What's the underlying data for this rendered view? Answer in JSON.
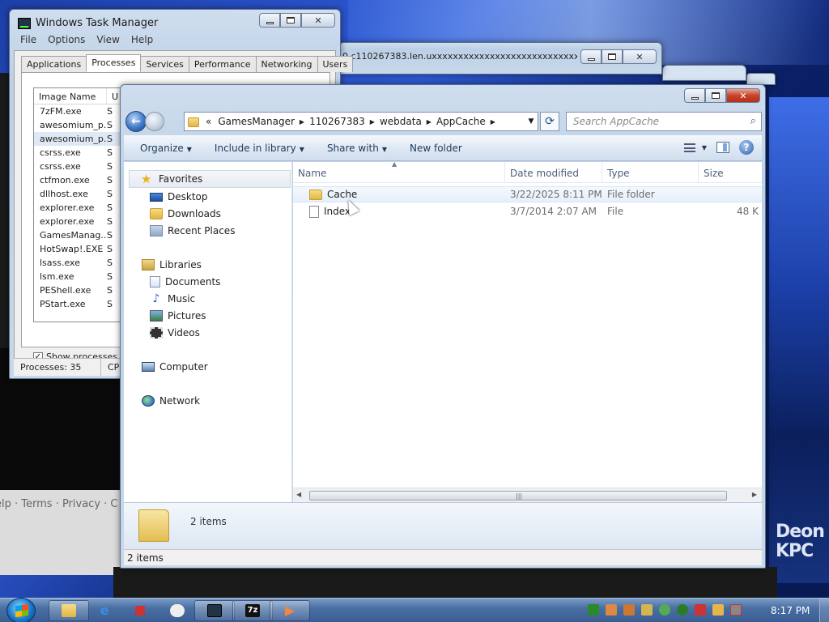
{
  "desktop": {
    "footer_links": "elp · Terms · Privacy · C",
    "right_text": "Deon\nKPC"
  },
  "taskmgr": {
    "title": "Windows Task Manager",
    "menu": [
      "File",
      "Options",
      "View",
      "Help"
    ],
    "tabs": [
      "Applications",
      "Processes",
      "Services",
      "Performance",
      "Networking",
      "Users"
    ],
    "active_tab": "Processes",
    "col_image_name": "Image Name",
    "col_user_abbr": "U",
    "processes": [
      {
        "name": "7zFM.exe",
        "user": "S"
      },
      {
        "name": "awesomium_p...",
        "user": "S"
      },
      {
        "name": "awesomium_p...",
        "user": "S"
      },
      {
        "name": "csrss.exe",
        "user": "S"
      },
      {
        "name": "csrss.exe",
        "user": "S"
      },
      {
        "name": "ctfmon.exe",
        "user": "S"
      },
      {
        "name": "dllhost.exe",
        "user": "S"
      },
      {
        "name": "explorer.exe",
        "user": "S"
      },
      {
        "name": "explorer.exe",
        "user": "S"
      },
      {
        "name": "GamesManag...",
        "user": "S"
      },
      {
        "name": "HotSwap!.EXE",
        "user": "S"
      },
      {
        "name": "lsass.exe",
        "user": "S"
      },
      {
        "name": "lsm.exe",
        "user": "S"
      },
      {
        "name": "PEShell.exe",
        "user": "S"
      },
      {
        "name": "PStart.exe",
        "user": "S"
      }
    ],
    "show_all_label": "Show processes fro",
    "status_processes": "Processes: 35",
    "status_cpu": "CPU"
  },
  "iewin": {
    "title": "0.c110267383.len.uxxxxxxxxxxxxxxxxxxxxxxxxxxxxxxxxxxxx..."
  },
  "explorer": {
    "breadcrumb": [
      "«",
      "GamesManager",
      "110267383",
      "webdata",
      "AppCache"
    ],
    "search_placeholder": "Search AppCache",
    "commands": {
      "organize": "Organize",
      "include_in_library": "Include in library",
      "share_with": "Share with",
      "new_folder": "New folder"
    },
    "nav": {
      "favorites": "Favorites",
      "desktop": "Desktop",
      "downloads": "Downloads",
      "recent_places": "Recent Places",
      "libraries": "Libraries",
      "documents": "Documents",
      "music": "Music",
      "pictures": "Pictures",
      "videos": "Videos",
      "computer": "Computer",
      "network": "Network"
    },
    "columns": {
      "name": "Name",
      "date": "Date modified",
      "type": "Type",
      "size": "Size"
    },
    "files": [
      {
        "name": "Cache",
        "date": "3/22/2025 8:11 PM",
        "type": "File folder",
        "size": "",
        "icon": "folder-icon"
      },
      {
        "name": "Index",
        "date": "3/7/2014 2:07 AM",
        "type": "File",
        "size": "48 K",
        "icon": "file-icon"
      }
    ],
    "details_count": "2 items",
    "status_count": "2 items"
  },
  "taskbar": {
    "clock": "8:17 PM",
    "app_7z_label": "7z"
  }
}
